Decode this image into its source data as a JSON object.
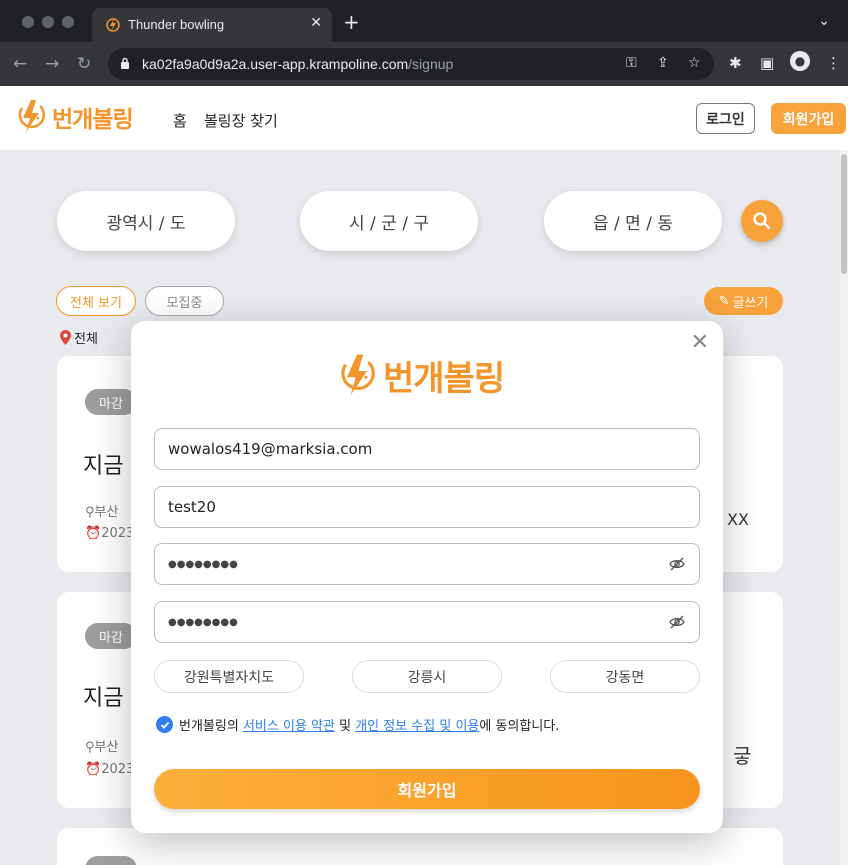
{
  "browser": {
    "tab_title": "Thunder bowling",
    "url_host": "ka02fa9a0d9a2a.user-app.krampoline.com",
    "url_path": "/signup"
  },
  "header": {
    "logo_text": "번개볼링",
    "nav": [
      "홈",
      "볼링장 찾기"
    ],
    "login_label": "로그인",
    "signup_label": "회원가입"
  },
  "search": {
    "regions": [
      "광역시 / 도",
      "시 / 군 / 구",
      "읍 / 면 / 동"
    ]
  },
  "filters": {
    "all_label": "전체 보기",
    "recruiting_label": "모집중",
    "write_label": "글쓰기",
    "location_label": "전체"
  },
  "cards": [
    {
      "badge": "마감",
      "title": "지금",
      "place": "부산",
      "date": "2023",
      "extra": "XX"
    },
    {
      "badge": "마감",
      "title": "지금",
      "place": "부산",
      "date": "2023",
      "extra": "긓"
    }
  ],
  "modal": {
    "logo_text": "번개볼링",
    "email_value": "wowalos419@marksia.com",
    "name_value": "test20",
    "password_mask": "●●●●●●●●",
    "password_confirm_mask": "●●●●●●●●",
    "region_selects": [
      "강원특별자치도",
      "강릉시",
      "강동면"
    ],
    "agree_prefix": "번개볼링의",
    "agree_terms_link": "서비스 이용 약관",
    "agree_and": "및",
    "agree_privacy_link": "개인 정보 수집 및 이용",
    "agree_suffix": "에 동의합니다.",
    "submit_label": "회원가입"
  },
  "colors": {
    "brand_orange": "#f7a23b",
    "link_blue": "#2f80ed"
  }
}
